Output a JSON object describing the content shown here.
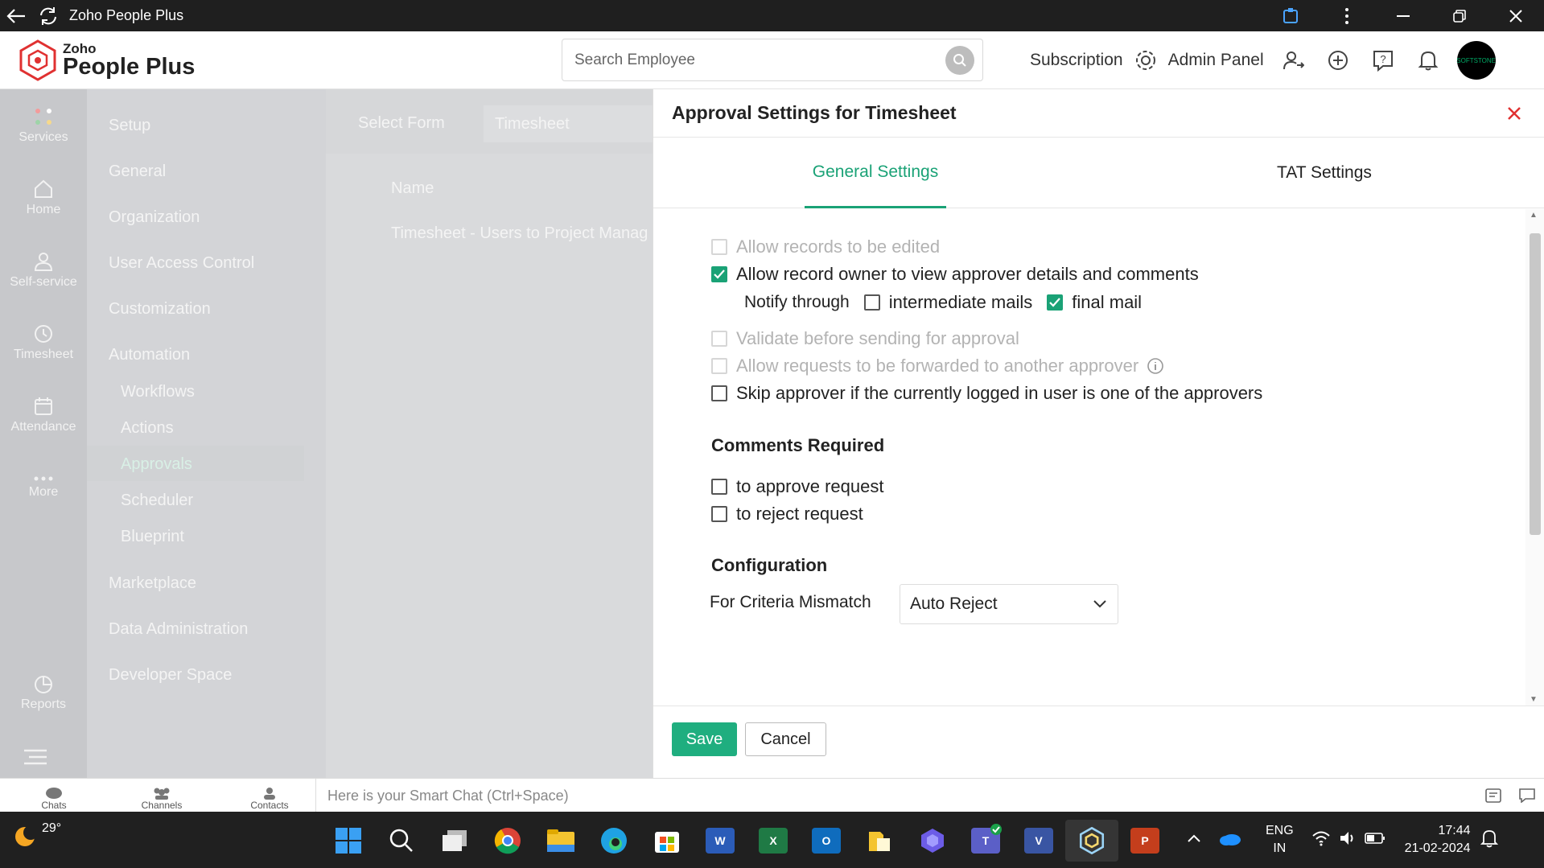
{
  "window": {
    "title": "Zoho People Plus"
  },
  "header": {
    "logo_small": "Zoho",
    "logo_big": "People Plus",
    "search_placeholder": "Search Employee",
    "subscription": "Subscription",
    "admin_panel": "Admin Panel",
    "avatar_text": "SOFTSTONE"
  },
  "rail": [
    {
      "label": "Services",
      "icon": "services-icon"
    },
    {
      "label": "Home",
      "icon": "home-icon"
    },
    {
      "label": "Self-service",
      "icon": "person-icon"
    },
    {
      "label": "Timesheet",
      "icon": "clock-icon"
    },
    {
      "label": "Attendance",
      "icon": "calendar-icon"
    },
    {
      "label": "More",
      "icon": "more-icon"
    },
    {
      "label": "Reports",
      "icon": "pie-icon"
    }
  ],
  "setup_nav": {
    "setup": "Setup",
    "general": "General",
    "organization": "Organization",
    "user_access": "User Access Control",
    "customization": "Customization",
    "automation": "Automation",
    "workflows": "Workflows",
    "actions": "Actions",
    "approvals": "Approvals",
    "scheduler": "Scheduler",
    "blueprint": "Blueprint",
    "marketplace": "Marketplace",
    "data_admin": "Data Administration",
    "developer": "Developer Space"
  },
  "behind": {
    "select_form": "Select Form",
    "form_value": "Timesheet",
    "name_header": "Name",
    "row1": "Timesheet - Users to Project Manag"
  },
  "panel": {
    "title": "Approval Settings for Timesheet",
    "tabs": [
      "General Settings",
      "TAT Settings"
    ],
    "options": {
      "allow_edit": "Allow records to be edited",
      "allow_owner_view": "Allow record owner to view approver details and comments",
      "notify_through": "Notify through",
      "intermediate_mails": "intermediate mails",
      "final_mail": "final mail",
      "validate": "Validate before sending for approval",
      "forward": "Allow requests to be forwarded to another approver",
      "skip": "Skip approver if the currently logged in user is one of the approvers"
    },
    "comments_required": "Comments Required",
    "to_approve": "to approve request",
    "to_reject": "to reject request",
    "configuration": "Configuration",
    "criteria_label": "For Criteria Mismatch",
    "criteria_value": "Auto Reject",
    "save": "Save",
    "cancel": "Cancel",
    "accent": "#1aa276"
  },
  "chatbar": {
    "tabs": [
      "Chats",
      "Channels",
      "Contacts"
    ],
    "placeholder": "Here is your Smart Chat (Ctrl+Space)"
  },
  "taskbar": {
    "temp": "29°",
    "lang1": "ENG",
    "lang2": "IN",
    "time": "17:44",
    "date": "21-02-2024"
  }
}
